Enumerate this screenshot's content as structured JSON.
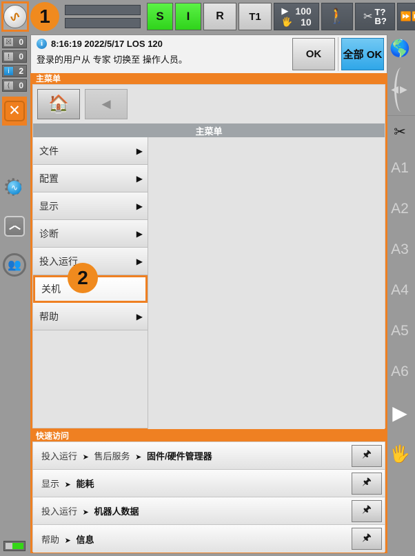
{
  "topbar": {
    "robot_icon": "kuka-robot-icon",
    "badge1": "1",
    "status_buttons": [
      {
        "name": "submit-interpreter-s",
        "label": "S",
        "style": "green"
      },
      {
        "name": "drives-i",
        "label": "I",
        "style": "green"
      },
      {
        "name": "robot-interpreter-r",
        "label": "R",
        "style": "grey"
      },
      {
        "name": "operating-mode-t1",
        "label": "T1",
        "style": "grey"
      }
    ],
    "override": {
      "program_value": "100",
      "jog_value": "10",
      "program_icon": "play-icon",
      "jog_icon": "hand-icon"
    },
    "jog_mode_icon": "walking-person-icon",
    "tool_icon": "tool-icon",
    "tool_label_top": "T?",
    "tool_label_bottom": "B?",
    "increment_icon": "step-increment-icon",
    "increment_label": "∞"
  },
  "left_sidebar": {
    "message_counters": [
      {
        "name": "acknowledge-messages",
        "icon": "ack-message-icon",
        "count": "0"
      },
      {
        "name": "status-messages",
        "icon": "warning-icon",
        "count": "0"
      },
      {
        "name": "info-messages",
        "icon": "info-icon",
        "count": "2"
      },
      {
        "name": "wait-messages",
        "icon": "wait-icon",
        "count": "0"
      }
    ],
    "stop_button_icon": "close-x-icon",
    "icons": [
      {
        "name": "robot-settings-icon",
        "glyph": "gear-robot-icon"
      },
      {
        "name": "clock-icon",
        "glyph": "clock-icon"
      },
      {
        "name": "users-icon",
        "glyph": "users-icon"
      }
    ],
    "battery_icon": "battery-icon"
  },
  "right_sidebar": {
    "globe_icon": "globe-icon",
    "coordinate_arrows_icon": "coordinate-arrows-icon",
    "tool_icon": "robot-tool-icon",
    "axes": [
      "A1",
      "A2",
      "A3",
      "A4",
      "A5",
      "A6"
    ],
    "play_icon": "play-icon",
    "hand_icon": "hand-jog-icon"
  },
  "message_window": {
    "info_icon": "info-icon",
    "timestamp": "8:16:19 2022/5/17 LOS 120",
    "text": "登录的用户从 专家 切换至 操作人员。",
    "ok_label": "OK",
    "ok_all_label": "全部 OK"
  },
  "main_menu": {
    "panel_title": "主菜单",
    "home_icon": "home-icon",
    "back_icon": "back-arrow-icon",
    "list_header": "主菜单",
    "badge2": "2",
    "items": [
      {
        "label": "文件",
        "arrow": "▶",
        "selected": false
      },
      {
        "label": "配置",
        "arrow": "▶",
        "selected": false
      },
      {
        "label": "显示",
        "arrow": "▶",
        "selected": false
      },
      {
        "label": "诊断",
        "arrow": "▶",
        "selected": false
      },
      {
        "label": "投入运行",
        "arrow": "▶",
        "selected": false
      },
      {
        "label": "关机",
        "arrow": "",
        "selected": true
      },
      {
        "label": "帮助",
        "arrow": "▶",
        "selected": false
      }
    ]
  },
  "quick_access": {
    "panel_title": "快速访问",
    "pin_icon": "pin-icon",
    "rows": [
      {
        "path": [
          "投入运行",
          "售后服务"
        ],
        "leaf": "固件/硬件管理器"
      },
      {
        "path": [
          "显示"
        ],
        "leaf": "能耗"
      },
      {
        "path": [
          "投入运行"
        ],
        "leaf": "机器人数据"
      },
      {
        "path": [
          "帮助"
        ],
        "leaf": "信息"
      }
    ]
  },
  "colors": {
    "accent_orange": "#ef8022",
    "green_status": "#34d617",
    "blue_button": "#2fa6e8",
    "panel_grey": "#9a9a9a"
  }
}
